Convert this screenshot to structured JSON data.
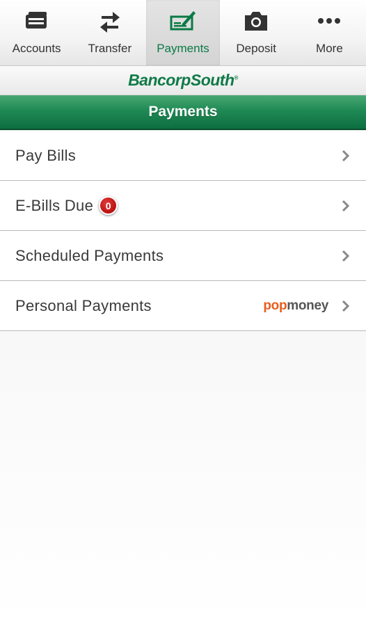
{
  "tabs": [
    {
      "label": "Accounts",
      "icon": "wallet-icon",
      "active": false
    },
    {
      "label": "Transfer",
      "icon": "transfer-arrows-icon",
      "active": false
    },
    {
      "label": "Payments",
      "icon": "check-pen-icon",
      "active": true
    },
    {
      "label": "Deposit",
      "icon": "camera-icon",
      "active": false
    },
    {
      "label": "More",
      "icon": "ellipsis-icon",
      "active": false
    }
  ],
  "brand": {
    "name": "BancorpSouth",
    "mark": "®"
  },
  "page_title": "Payments",
  "rows": [
    {
      "label": "Pay Bills"
    },
    {
      "label": "E-Bills Due",
      "badge": "0"
    },
    {
      "label": "Scheduled Payments"
    },
    {
      "label": "Personal Payments",
      "logo_pop": "pop",
      "logo_money": "money"
    }
  ],
  "colors": {
    "brand_green": "#0f7a47",
    "badge_red": "#c40000",
    "popmoney_orange": "#e85d1c"
  }
}
